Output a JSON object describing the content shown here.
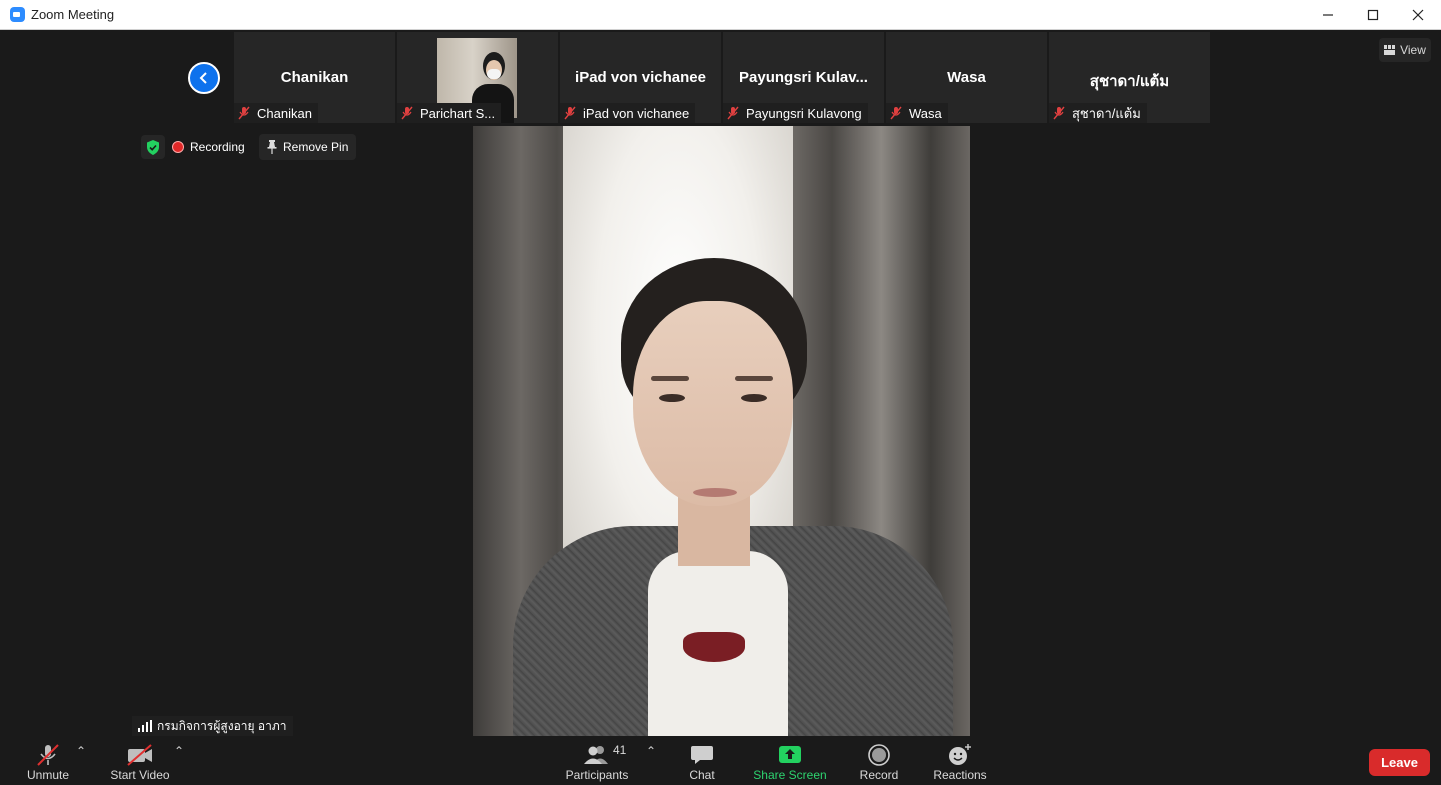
{
  "window": {
    "title": "Zoom Meeting"
  },
  "view_button": "View",
  "tiles": [
    {
      "display_name": "Chanikan",
      "label": "Chanikan",
      "has_video": false
    },
    {
      "display_name": "",
      "label": "Parichart S...",
      "has_video": true
    },
    {
      "display_name": "iPad von vichanee",
      "label": "iPad von vichanee",
      "has_video": false
    },
    {
      "display_name": "Payungsri  Kulav...",
      "label": "Payungsri Kulavong",
      "has_video": false
    },
    {
      "display_name": "Wasa",
      "label": "Wasa",
      "has_video": false
    },
    {
      "display_name": "สุชาดา/แต้ม",
      "label": "สุชาดา/แต้ม",
      "has_video": false
    }
  ],
  "meeting_status": {
    "recording": "Recording",
    "remove_pin": "Remove Pin"
  },
  "active_speaker_name": "กรมกิจการผู้สูงอายุ อาภา",
  "toolbar": {
    "unmute": "Unmute",
    "start_video": "Start Video",
    "participants": "Participants",
    "participants_count": "41",
    "chat": "Chat",
    "share_screen": "Share Screen",
    "record": "Record",
    "reactions": "Reactions",
    "leave": "Leave"
  },
  "colors": {
    "accent_blue": "#0e72ed",
    "share_green": "#2dd36f",
    "leave_red": "#d92b2b",
    "background": "#1a1a1a"
  }
}
